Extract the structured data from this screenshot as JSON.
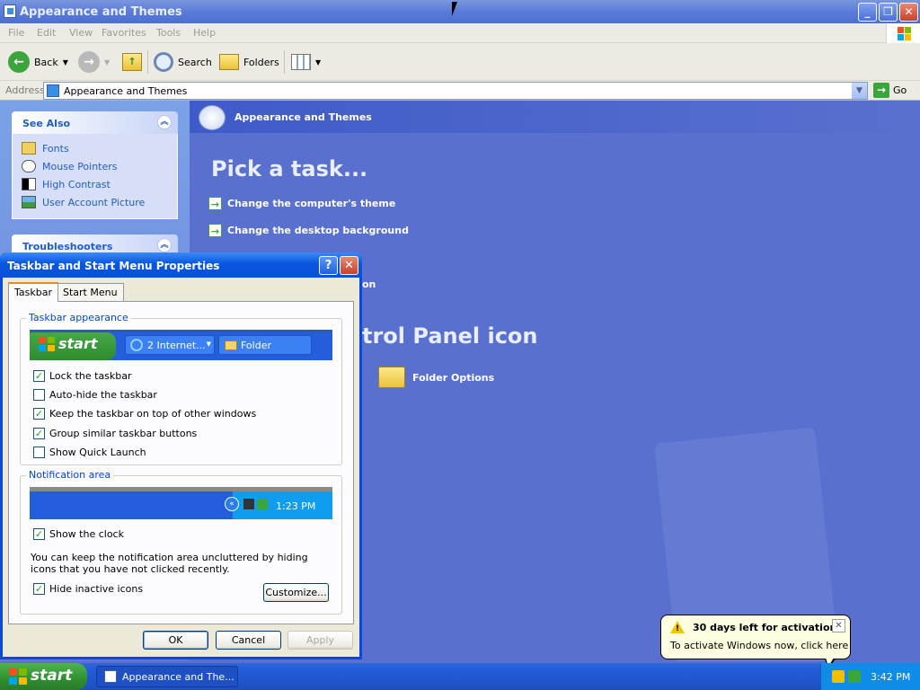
{
  "window": {
    "title": "Appearance and Themes"
  },
  "menu": [
    "File",
    "Edit",
    "View",
    "Favorites",
    "Tools",
    "Help"
  ],
  "toolbar": {
    "back_label": "Back",
    "search_label": "Search",
    "folders_label": "Folders"
  },
  "address": {
    "label": "Address",
    "value": "Appearance and Themes",
    "go_label": "Go"
  },
  "left_pane": {
    "see_also": {
      "title": "See Also",
      "items": [
        {
          "label": "Fonts",
          "icon": "fonts-folder-icon"
        },
        {
          "label": "Mouse Pointers",
          "icon": "mouse-icon"
        },
        {
          "label": "High Contrast",
          "icon": "contrast-icon"
        },
        {
          "label": "User Account Picture",
          "icon": "picture-icon"
        }
      ]
    },
    "troubleshooters": {
      "title": "Troubleshooters"
    }
  },
  "main": {
    "header": "Appearance and Themes",
    "pick_task": "Pick a task...",
    "tasks": [
      "Change the computer's theme",
      "Change the desktop background"
    ],
    "task_partial": "on",
    "cp_title_partial": "trol Panel icon",
    "cp_items": [
      "Folder Options"
    ]
  },
  "dialog": {
    "title": "Taskbar and Start Menu Properties",
    "tabs": [
      "Taskbar",
      "Start Menu"
    ],
    "taskbar_appearance": {
      "label": "Taskbar appearance",
      "preview_start": "start",
      "preview_buttons": [
        "2 Internet...",
        "Folder"
      ],
      "options": [
        {
          "label": "Lock the taskbar",
          "checked": true
        },
        {
          "label": "Auto-hide the taskbar",
          "checked": false
        },
        {
          "label": "Keep the taskbar on top of other windows",
          "checked": true
        },
        {
          "label": "Group similar taskbar buttons",
          "checked": true
        },
        {
          "label": "Show Quick Launch",
          "checked": false
        }
      ]
    },
    "notification_area": {
      "label": "Notification area",
      "preview_clock": "1:23 PM",
      "show_clock": {
        "label": "Show the clock",
        "checked": true
      },
      "description": "You can keep the notification area uncluttered by hiding icons that you have not clicked recently.",
      "hide_inactive": {
        "label": "Hide inactive icons",
        "checked": true
      },
      "customize_label": "Customize..."
    },
    "buttons": {
      "ok": "OK",
      "cancel": "Cancel",
      "apply": "Apply"
    }
  },
  "balloon": {
    "title": "30 days left for activation",
    "text": "To activate Windows now, click here"
  },
  "taskbar": {
    "start_label": "start",
    "task_button": "Appearance and The...",
    "clock": "3:42 PM"
  },
  "colors": {
    "accent": "#0a4ad8",
    "panel_blue": "#5a70cf",
    "start_green": "#3a9a3a",
    "balloon_bg": "#ffffe1"
  }
}
